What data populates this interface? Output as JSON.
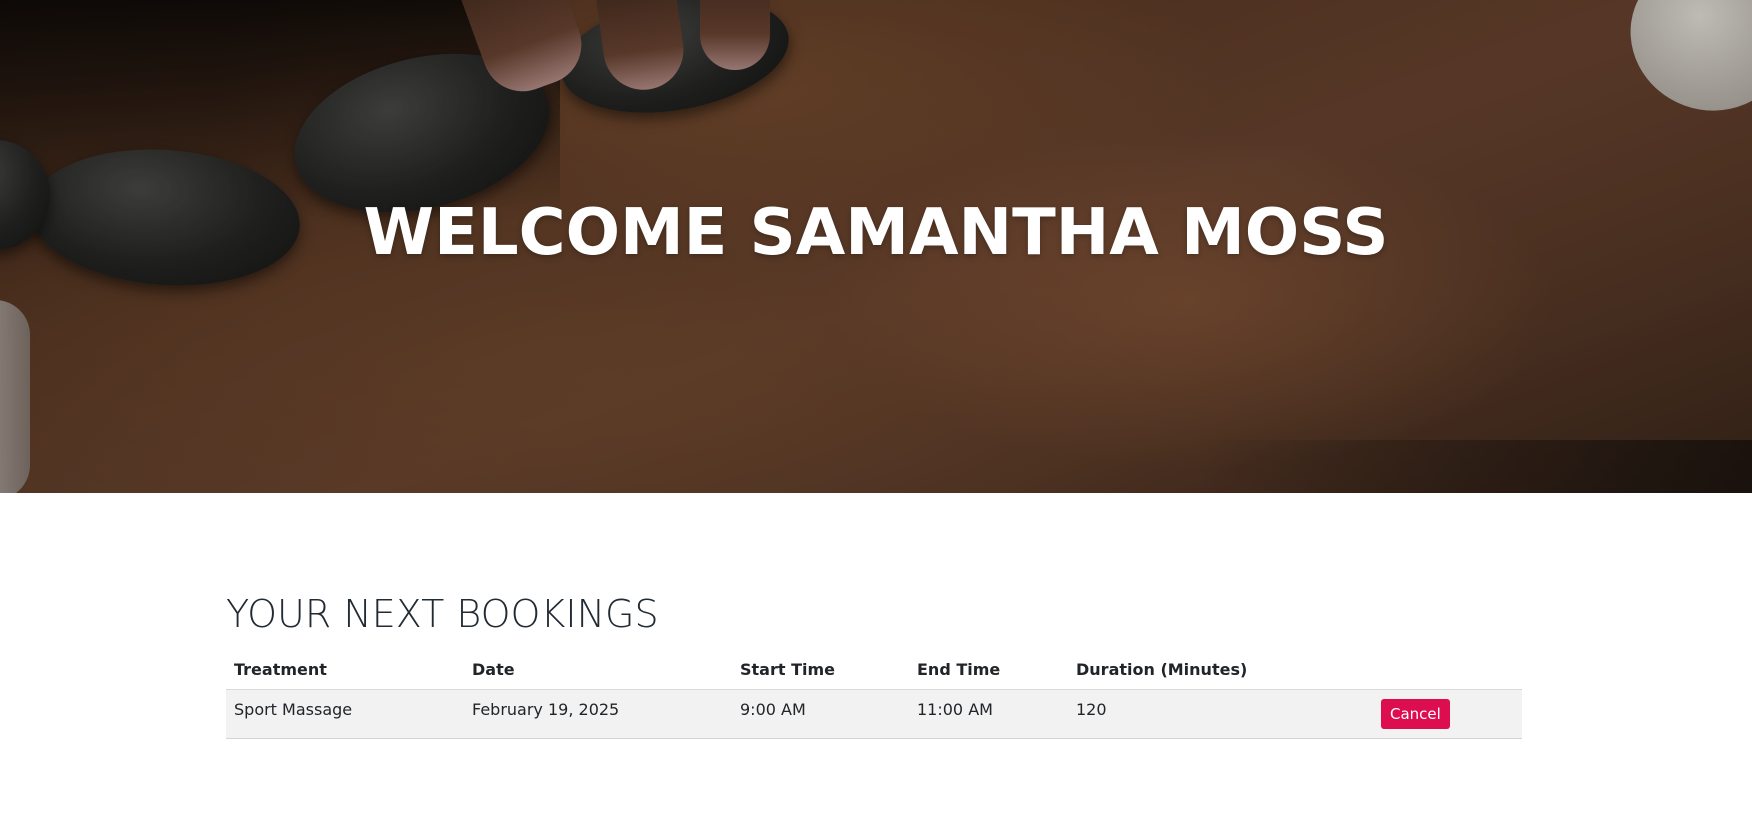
{
  "hero": {
    "title": "WELCOME SAMANTHA MOSS"
  },
  "bookings": {
    "heading": "YOUR NEXT BOOKINGS",
    "columns": [
      "Treatment",
      "Date",
      "Start Time",
      "End Time",
      "Duration (Minutes)",
      ""
    ],
    "rows": [
      {
        "treatment": "Sport Massage",
        "date": "February 19, 2025",
        "start_time": "9:00 AM",
        "end_time": "11:00 AM",
        "duration": "120",
        "action_label": "Cancel"
      }
    ]
  },
  "colors": {
    "cancel_button": "#dc0e50",
    "row_background": "#f2f2f2",
    "text": "#212529"
  }
}
